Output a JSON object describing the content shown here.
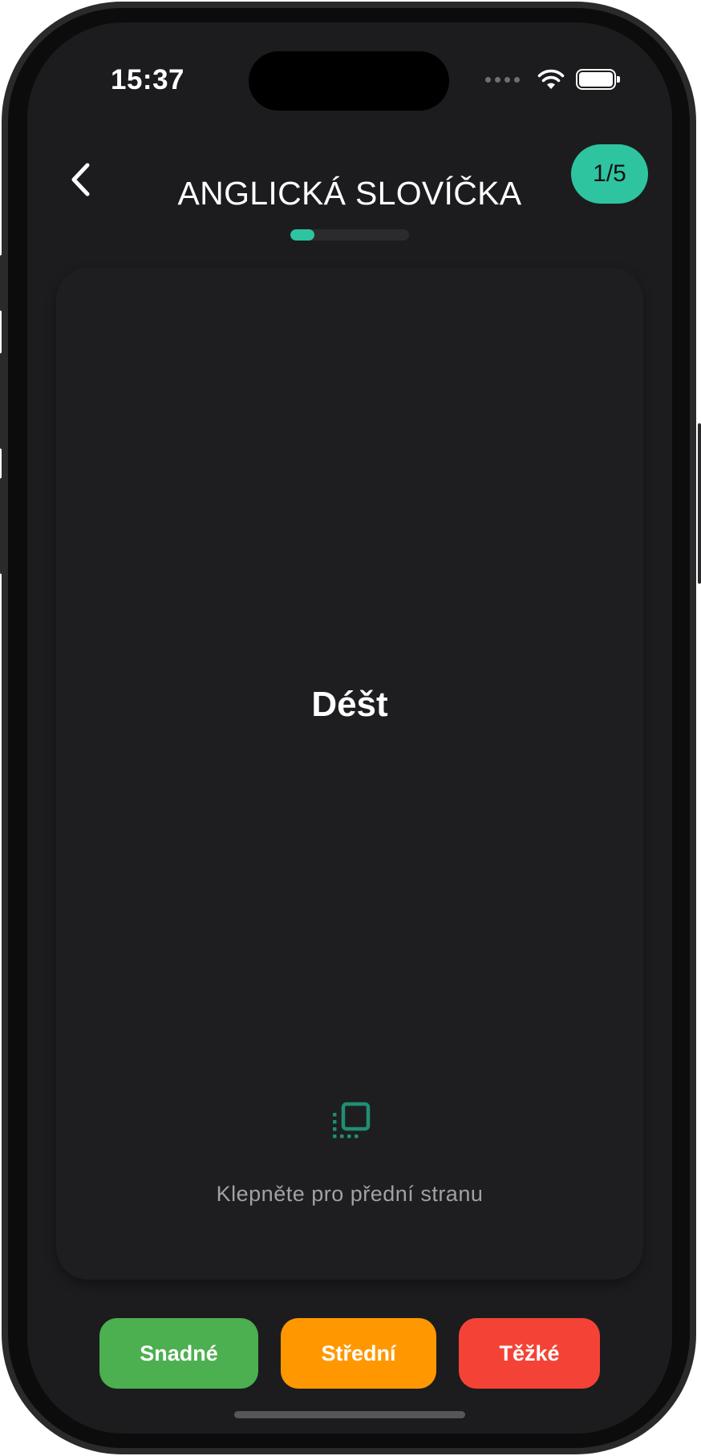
{
  "status_bar": {
    "time": "15:37"
  },
  "header": {
    "title": "ANGLICKÁ SLOVÍČKA",
    "counter": "1/5",
    "progress_fraction": 0.2
  },
  "card": {
    "word": "Déšt",
    "hint": "Klepněte pro přední stranu"
  },
  "buttons": {
    "easy": "Snadné",
    "medium": "Střední",
    "hard": "Těžké"
  },
  "colors": {
    "accent": "#2ec4a0",
    "easy": "#4caf50",
    "medium": "#ff9800",
    "hard": "#f44336",
    "background": "#1c1c1e"
  },
  "icons": {
    "back": "chevron-left-icon",
    "flip": "flip-card-icon",
    "wifi": "wifi-icon",
    "battery": "battery-icon",
    "signal": "signal-icon"
  }
}
